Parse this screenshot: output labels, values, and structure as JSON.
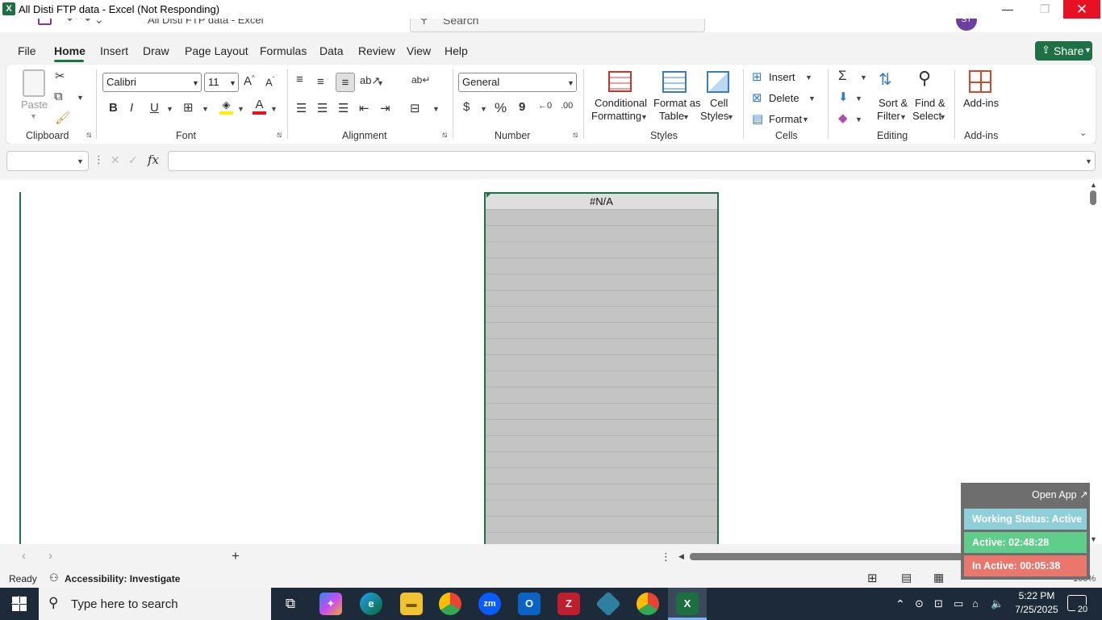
{
  "window": {
    "title": "All Disti FTP data - Excel (Not Responding)",
    "ghost_title": "All Disti FTP data  -  Excel",
    "logo_letter": "X",
    "minimize": "—",
    "maximize": "❐",
    "close": "✕"
  },
  "search": {
    "placeholder": "Search"
  },
  "user": {
    "initials": "ST"
  },
  "tabs": [
    "File",
    "Home",
    "Insert",
    "Draw",
    "Page Layout",
    "Formulas",
    "Data",
    "Review",
    "View",
    "Help"
  ],
  "share_label": "Share",
  "ribbon": {
    "clipboard": {
      "paste": "Paste",
      "label": "Clipboard"
    },
    "font": {
      "name": "Calibri",
      "size": "11",
      "bold": "B",
      "italic": "I",
      "underline": "U",
      "label": "Font"
    },
    "alignment": {
      "label": "Alignment"
    },
    "number": {
      "format": "General",
      "currency": "$",
      "percent": "%",
      "comma": "9",
      "label": "Number"
    },
    "styles": {
      "conditional_1": "Conditional",
      "conditional_2": "Formatting",
      "format_table_1": "Format as",
      "format_table_2": "Table",
      "cell_styles_1": "Cell",
      "cell_styles_2": "Styles",
      "label": "Styles"
    },
    "cells": {
      "insert": "Insert",
      "delete": "Delete",
      "format": "Format",
      "label": "Cells"
    },
    "editing": {
      "sort_1": "Sort &",
      "sort_2": "Filter",
      "find_1": "Find &",
      "find_2": "Select",
      "label": "Editing"
    },
    "addins": {
      "button": "Add-ins",
      "label": "Add-ins"
    }
  },
  "formula_bar": {
    "fx": "fx",
    "name_box": ""
  },
  "cell": {
    "value": "#N/A"
  },
  "status": {
    "ready": "Ready",
    "accessibility": "Accessibility: Investigate",
    "zoom": "100%"
  },
  "widget": {
    "open_app": "Open App ↗",
    "working_status": "Working Status: Active",
    "active": "Active: 02:48:28",
    "inactive": "In Active: 00:05:38"
  },
  "taskbar": {
    "search_placeholder": "Type here to search",
    "time": "5:22 PM",
    "date": "7/25/2025",
    "notifications": "20",
    "apps": [
      "Task View",
      "Copilot",
      "Edge",
      "File Explorer",
      "Chrome",
      "Zoom",
      "Outlook",
      "FileZilla",
      "App",
      "Chrome Profile",
      "Excel"
    ]
  },
  "colors": {
    "accent": "#1e7145",
    "close": "#e81123",
    "status_active": "#8fcfda",
    "active_green": "#5fce8a",
    "inactive_red": "#e9776e"
  }
}
